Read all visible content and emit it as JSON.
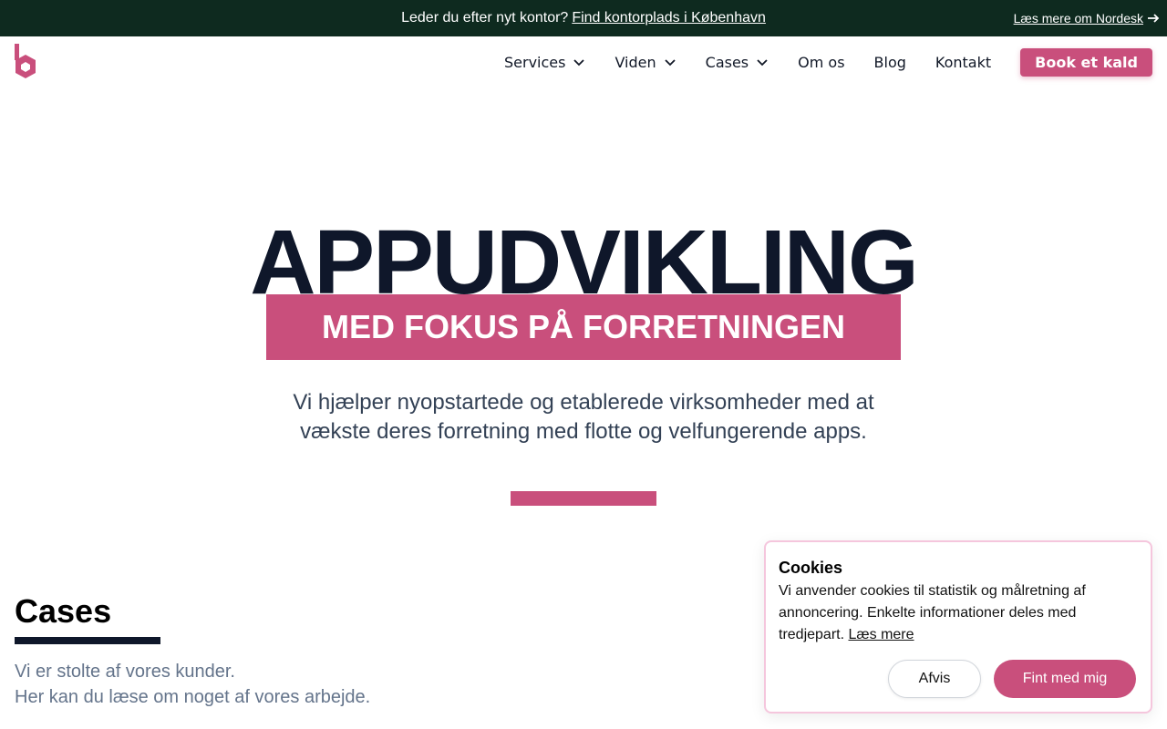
{
  "topbar": {
    "text": "Leder du efter nyt kontor?",
    "link": "Find kontorplads i København",
    "right_link": "Læs mere om Nordesk"
  },
  "nav": {
    "items": [
      {
        "label": "Services",
        "dropdown": true
      },
      {
        "label": "Viden",
        "dropdown": true
      },
      {
        "label": "Cases",
        "dropdown": true
      },
      {
        "label": "Om os",
        "dropdown": false
      },
      {
        "label": "Blog",
        "dropdown": false
      },
      {
        "label": "Kontakt",
        "dropdown": false
      }
    ],
    "cta": "Book et kald"
  },
  "hero": {
    "title": "APPUDVIKLING",
    "subtitle": "MED FOKUS PÅ FORRETNINGEN",
    "description": "Vi hjælper nyopstartede og etablerede virksomheder med at vækste deres forretning med flotte og velfungerende apps."
  },
  "cases": {
    "title": "Cases",
    "line1": "Vi er stolte af vores kunder.",
    "line2": "Her kan du læse om noget af vores arbejde."
  },
  "cookie": {
    "title": "Cookies",
    "text": "Vi anvender cookies til statistik og målretning af annoncering. Enkelte informationer deles med tredjepart.",
    "link": "Læs mere",
    "reject": "Afvis",
    "accept": "Fint med mig"
  },
  "colors": {
    "brand": "#c94f7c",
    "topbar": "#0e2a1f",
    "dark": "#0f172a"
  },
  "icons": [
    "logo-icon",
    "arrow-right-icon",
    "chevron-down-icon"
  ]
}
